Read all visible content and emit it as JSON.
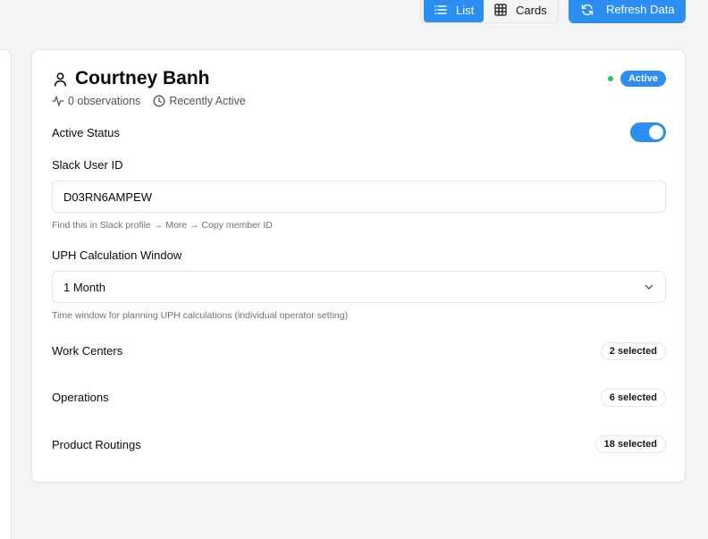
{
  "toolbar": {
    "list_label": "List",
    "cards_label": "Cards",
    "refresh_label": "Refresh Data"
  },
  "operator": {
    "name": "Courtney Banh",
    "observations": "0 observations",
    "activity": "Recently Active",
    "status": "Active",
    "status_color": "#22c55e"
  },
  "form": {
    "active_status_label": "Active Status",
    "active_status_on": true,
    "slack_label": "Slack User ID",
    "slack_value": "D03RN6AMPEW",
    "slack_hint": "Find this in Slack profile → More → Copy member ID",
    "uph_label": "UPH Calculation Window",
    "uph_value": "1 Month",
    "uph_hint": "Time window for planning UPH calculations (individual operator setting)"
  },
  "selections": {
    "work_centers_label": "Work Centers",
    "work_centers_count": "2 selected",
    "operations_label": "Operations",
    "operations_count": "6 selected",
    "routings_label": "Product Routings",
    "routings_count": "18 selected"
  },
  "colors": {
    "accent": "#2b8ef0",
    "background": "#f4f4f5"
  }
}
